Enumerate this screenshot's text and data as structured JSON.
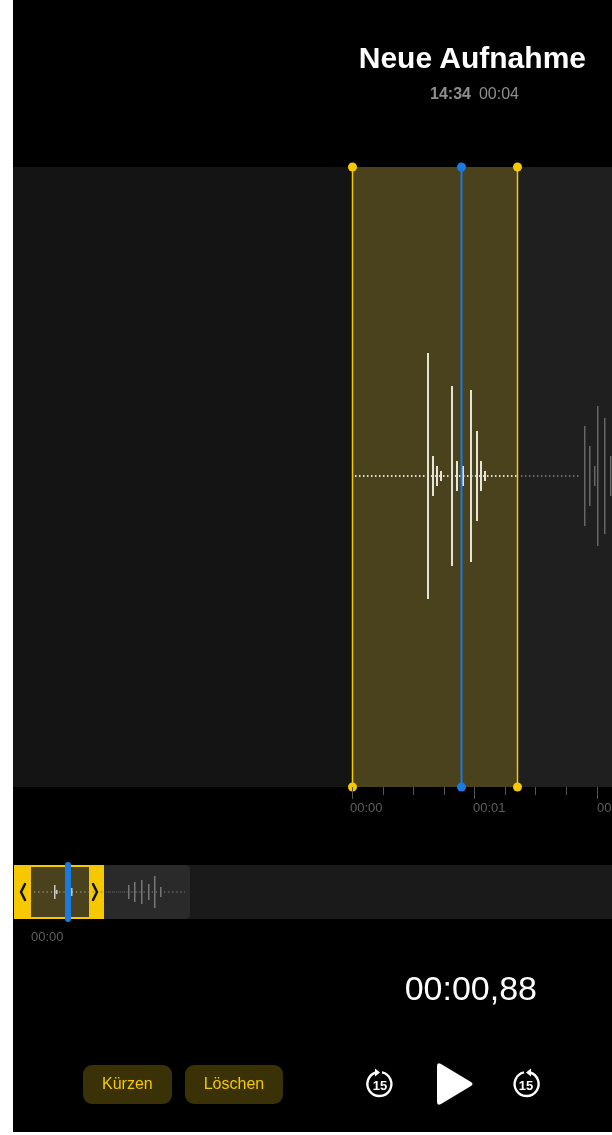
{
  "recording": {
    "title": "Neue Aufnahme",
    "date": "14:34",
    "duration": "00:04"
  },
  "ruler": {
    "labels": [
      "00:00",
      "00:01",
      "00"
    ]
  },
  "overview": {
    "label": "00:00"
  },
  "current_time": "00:00,88",
  "buttons": [
    {
      "label": "Kürzen"
    },
    {
      "label": "Löschen"
    }
  ],
  "transport": {
    "skip_back": "15",
    "skip_forward": "15",
    "playing": false
  }
}
